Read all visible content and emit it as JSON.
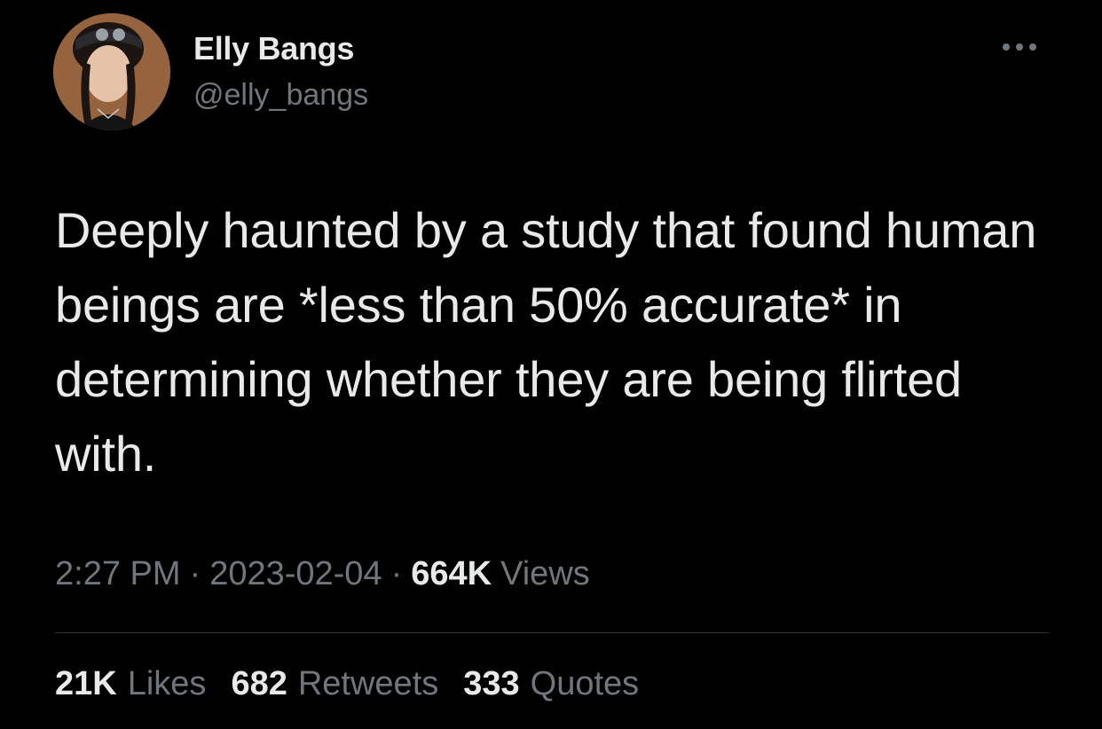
{
  "author": {
    "display_name": "Elly Bangs",
    "handle": "@elly_bangs"
  },
  "tweet": {
    "text": "Deeply haunted by a study that found human beings are *less than 50% accurate* in determining whether they are being flirted with."
  },
  "meta": {
    "time": "2:27 PM",
    "separator": "·",
    "date": "2023-02-04",
    "views_count": "664K",
    "views_label": "Views"
  },
  "stats": {
    "likes_count": "21K",
    "likes_label": "Likes",
    "retweets_count": "682",
    "retweets_label": "Retweets",
    "quotes_count": "333",
    "quotes_label": "Quotes"
  },
  "icons": {
    "more": "more-horizontal-icon"
  },
  "colors": {
    "background": "#000000",
    "primary_text": "#e7e9ea",
    "secondary_text": "#71767b",
    "divider": "#2f3336"
  }
}
